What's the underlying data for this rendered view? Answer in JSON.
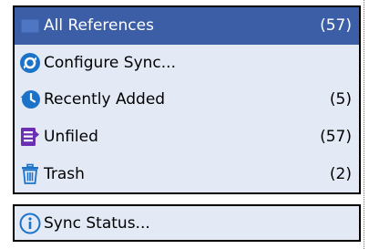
{
  "main_list": {
    "items": [
      {
        "label": "All References",
        "count": "(57)",
        "icon": "folder-icon",
        "selected": true
      },
      {
        "label": "Configure Sync...",
        "count": "",
        "icon": "sync-icon",
        "selected": false
      },
      {
        "label": "Recently Added",
        "count": "(5)",
        "icon": "history-icon",
        "selected": false
      },
      {
        "label": "Unfiled",
        "count": "(57)",
        "icon": "unfiled-icon",
        "selected": false
      },
      {
        "label": "Trash",
        "count": "(2)",
        "icon": "trash-icon",
        "selected": false
      }
    ]
  },
  "status_list": {
    "items": [
      {
        "label": "Sync Status...",
        "icon": "info-icon"
      }
    ]
  },
  "colors": {
    "selection": "#3b5ea6",
    "panel_bg": "#e3eaf6",
    "icon_blue": "#1a73c9",
    "icon_purple": "#6b2fb3"
  }
}
